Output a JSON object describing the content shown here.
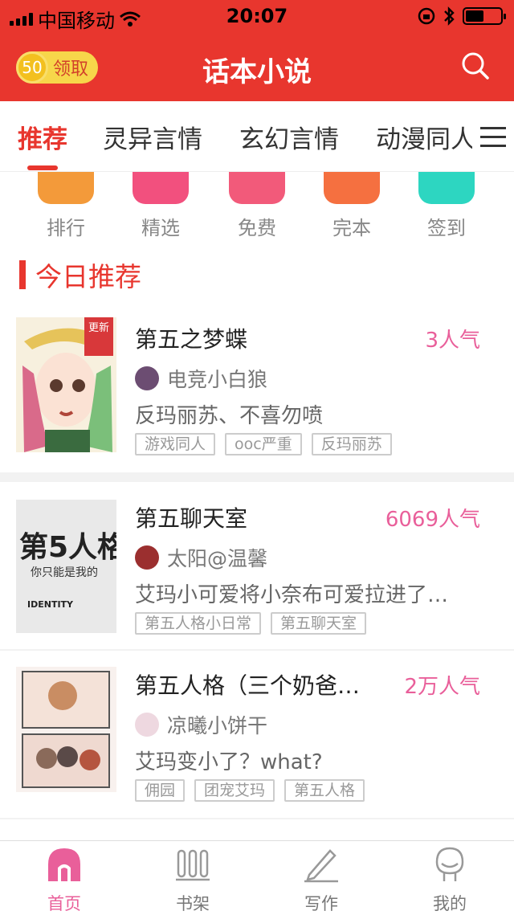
{
  "status_bar": {
    "carrier": "中国移动",
    "time": "20:07"
  },
  "header": {
    "coins": "50",
    "claim_label": "领取",
    "title": "话本小说"
  },
  "tabs": [
    {
      "label": "推荐",
      "active": true
    },
    {
      "label": "灵异言情",
      "active": false
    },
    {
      "label": "玄幻言情",
      "active": false
    },
    {
      "label": "动漫同人",
      "active": false
    }
  ],
  "shortcuts": [
    {
      "label": "排行",
      "icon": "trophy-icon",
      "color": "#f39a3a"
    },
    {
      "label": "精选",
      "icon": "star-icon",
      "color": "#f2507e"
    },
    {
      "label": "免费",
      "icon": "free-icon",
      "color": "#f25a7a"
    },
    {
      "label": "完本",
      "icon": "check-icon",
      "color": "#f57040"
    },
    {
      "label": "签到",
      "icon": "sign-in-icon",
      "color": "#2dd6c1"
    }
  ],
  "section": {
    "title": "今日推荐"
  },
  "books": [
    {
      "title": "第五之梦蝶",
      "popularity": "3人气",
      "author": "电竞小白狼",
      "description": "反玛丽苏、不喜勿喷",
      "tags": [
        "游戏同人",
        "ooc严重",
        "反玛丽苏"
      ],
      "badge": "更新",
      "cover_colors": [
        "#e9d8b0",
        "#5b3a2e",
        "#b0463a"
      ]
    },
    {
      "title": "第五聊天室",
      "popularity": "6069人气",
      "author": "太阳@温馨",
      "description": "艾玛小可爱将小奈布可爱拉进了…",
      "tags": [
        "第五人格小日常",
        "第五聊天室"
      ],
      "cover_text": "第5人格",
      "cover_sub": "你只能是我的",
      "cover_brand": "IDENTITY"
    },
    {
      "title": "第五人格（三个奶爸…",
      "popularity": "2万人气",
      "author": "凉曦小饼干",
      "description": "艾玛变小了？what?",
      "tags": [
        "佣园",
        "团宠艾玛",
        "第五人格"
      ]
    }
  ],
  "tabbar": [
    {
      "label": "首页",
      "icon": "home-icon",
      "active": true
    },
    {
      "label": "书架",
      "icon": "bookshelf-icon",
      "active": false
    },
    {
      "label": "写作",
      "icon": "pencil-icon",
      "active": false
    },
    {
      "label": "我的",
      "icon": "profile-icon",
      "active": false
    }
  ],
  "colors": {
    "brand": "#e8362e",
    "accent_pink": "#e95f9a"
  }
}
